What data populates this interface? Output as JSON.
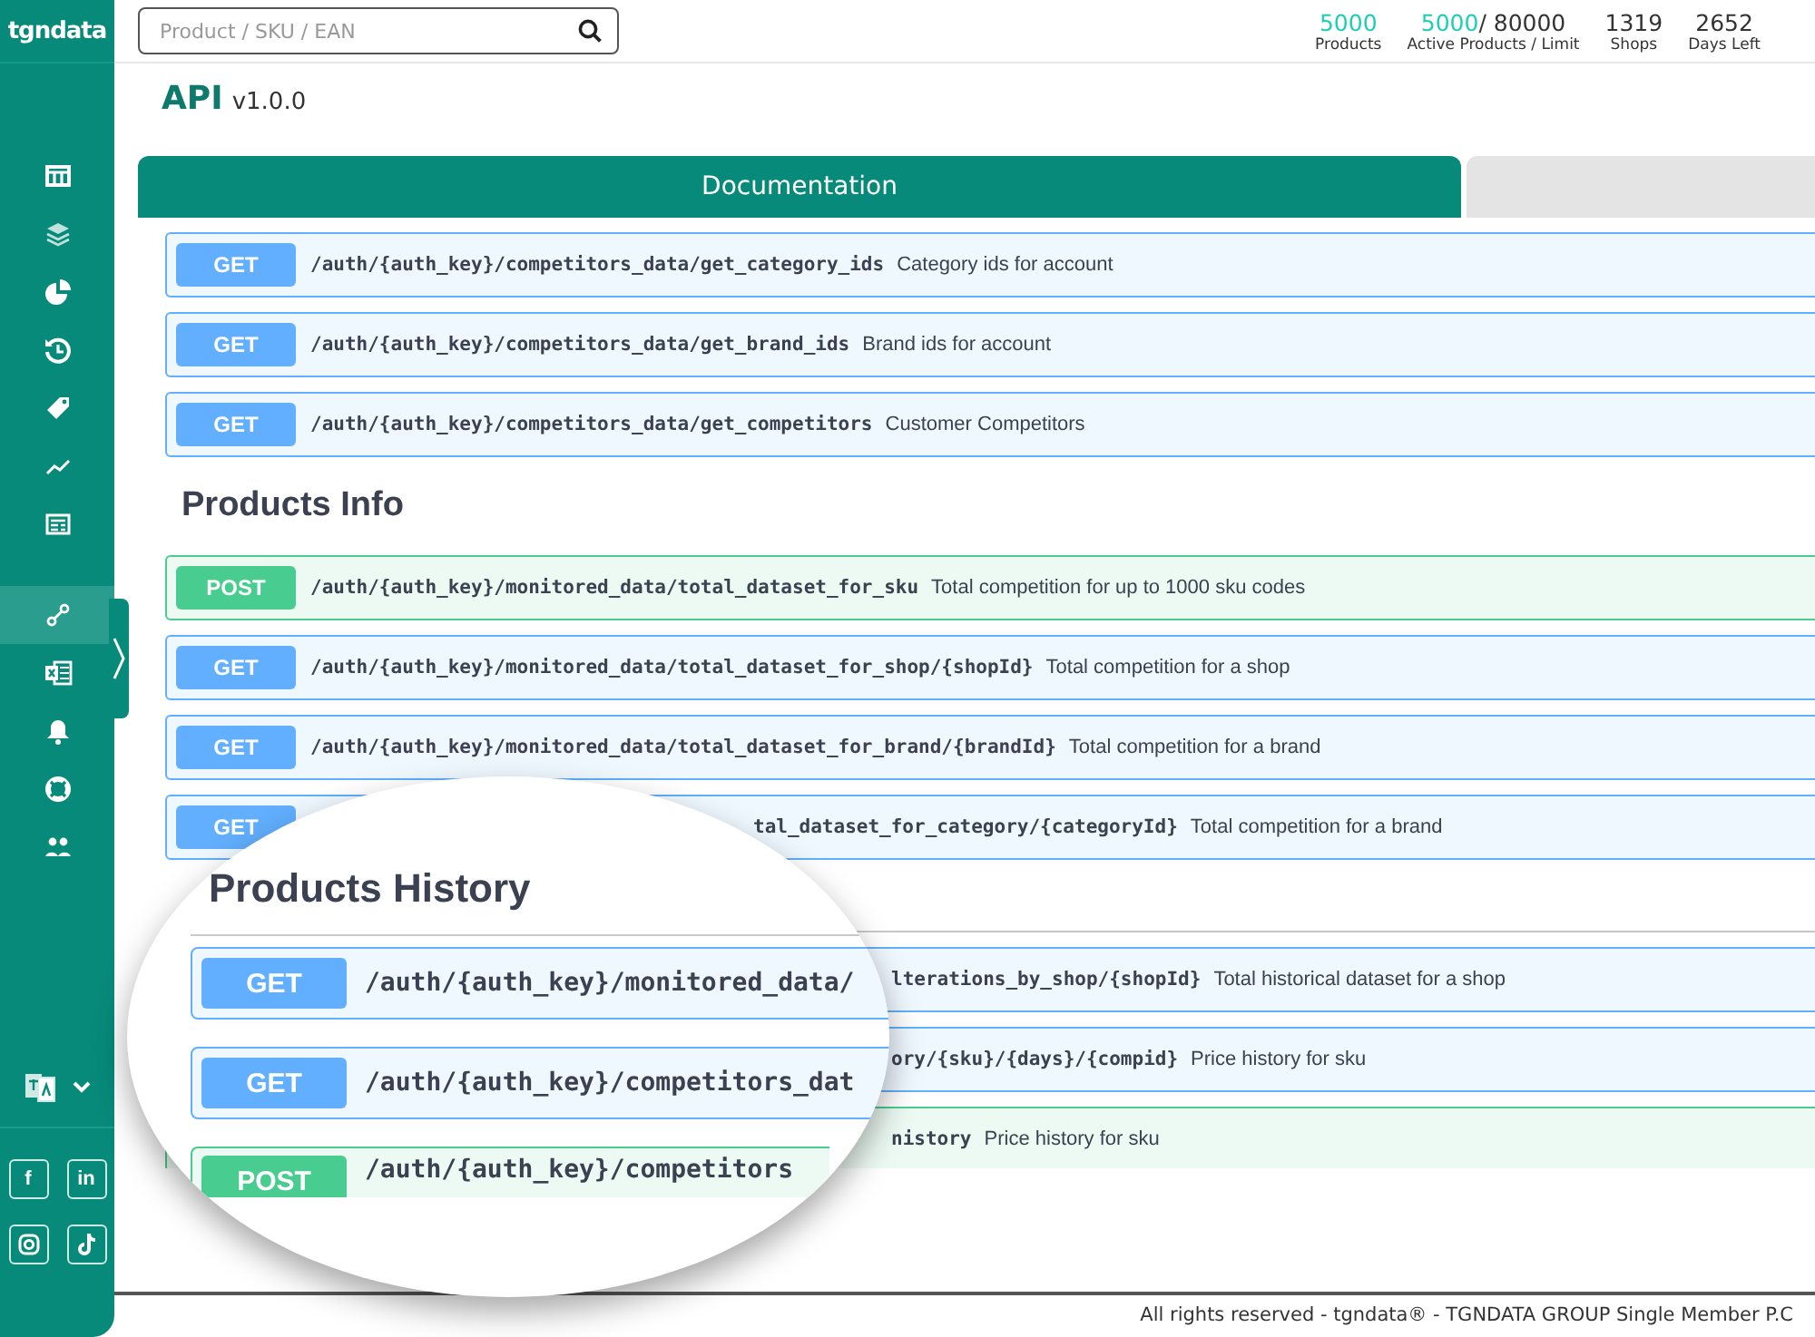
{
  "logo": "tgndata",
  "sidebar": {
    "items": [
      {
        "kind": "table",
        "selected": false
      },
      {
        "kind": "layers",
        "selected": false
      },
      {
        "kind": "pie",
        "selected": false
      },
      {
        "kind": "history",
        "selected": false
      },
      {
        "kind": "tag",
        "selected": false
      },
      {
        "kind": "trend",
        "selected": false
      },
      {
        "kind": "news",
        "selected": false
      },
      {
        "kind": "link",
        "selected": true
      },
      {
        "kind": "sheet",
        "selected": false
      },
      {
        "kind": "bell",
        "selected": false
      },
      {
        "kind": "lifebuoy",
        "selected": false
      },
      {
        "kind": "users",
        "selected": false
      }
    ],
    "social": [
      {
        "kind": "facebook",
        "glyph": "f"
      },
      {
        "kind": "linkedin",
        "glyph": "in"
      },
      {
        "kind": "instagram"
      },
      {
        "kind": "tiktok"
      }
    ]
  },
  "search": {
    "placeholder": "Product / SKU / EAN"
  },
  "stats": [
    {
      "value": "5000",
      "label": "Products",
      "highlight": true
    },
    {
      "value": "5000",
      "rest": "/ 80000",
      "label": "Active Products / Limit",
      "highlight": true
    },
    {
      "value": "1319",
      "label": "Shops",
      "highlight": false
    },
    {
      "value": "2652",
      "label": "Days Left",
      "highlight": false
    }
  ],
  "page": {
    "title": "API",
    "version": "v1.0.0"
  },
  "tabs": [
    {
      "label": "Documentation",
      "selected": true
    },
    {
      "selected": false
    }
  ],
  "sections": [
    {
      "rows": [
        {
          "method": "GET",
          "kind": "get",
          "path": "/auth/{auth_key}/competitors_data/get_category_ids",
          "desc": "Category ids for account"
        },
        {
          "method": "GET",
          "kind": "get",
          "path": "/auth/{auth_key}/competitors_data/get_brand_ids",
          "desc": "Brand ids for account"
        },
        {
          "method": "GET",
          "kind": "get",
          "path": "/auth/{auth_key}/competitors_data/get_competitors",
          "desc": "Customer Competitors"
        }
      ]
    },
    {
      "heading": "Products Info",
      "rows": [
        {
          "method": "POST",
          "kind": "post",
          "path": "/auth/{auth_key}/monitored_data/total_dataset_for_sku",
          "desc": "Total competition for up to 1000 sku codes"
        },
        {
          "method": "GET",
          "kind": "get",
          "path": "/auth/{auth_key}/monitored_data/total_dataset_for_shop/{shopId}",
          "desc": "Total competition for a shop"
        },
        {
          "method": "GET",
          "kind": "get",
          "path": "/auth/{auth_key}/monitored_data/total_dataset_for_brand/{brandId}",
          "desc": "Total competition for a brand"
        },
        {
          "method": "GET",
          "kind": "get",
          "covered": true,
          "path": "tal_dataset_for_category/{categoryId}",
          "desc": "Total competition for a brand"
        }
      ]
    },
    {
      "rows": [
        {
          "kind": "get",
          "covered": true,
          "path": "lterations_by_shop/{shopId}",
          "desc": "Total historical dataset for a shop"
        },
        {
          "kind": "get",
          "covered": true,
          "path": "ory/{sku}/{days}/{compid}",
          "desc": "Price history for sku"
        },
        {
          "kind": "post",
          "covered": true,
          "path": "nistory",
          "desc": "Price history for sku"
        }
      ]
    }
  ],
  "magnifier": {
    "heading": "Products History",
    "rows": [
      {
        "method": "GET",
        "kind": "get",
        "path": "/auth/{auth_key}/monitored_data/"
      },
      {
        "method": "GET",
        "kind": "get",
        "path": "/auth/{auth_key}/competitors_dat"
      },
      {
        "method": "POST",
        "kind": "post",
        "path": "/auth/{auth_key}/competitors"
      }
    ]
  },
  "footer": "All rights reserved - tgndata® - TGNDATA GROUP Single Member P.C"
}
